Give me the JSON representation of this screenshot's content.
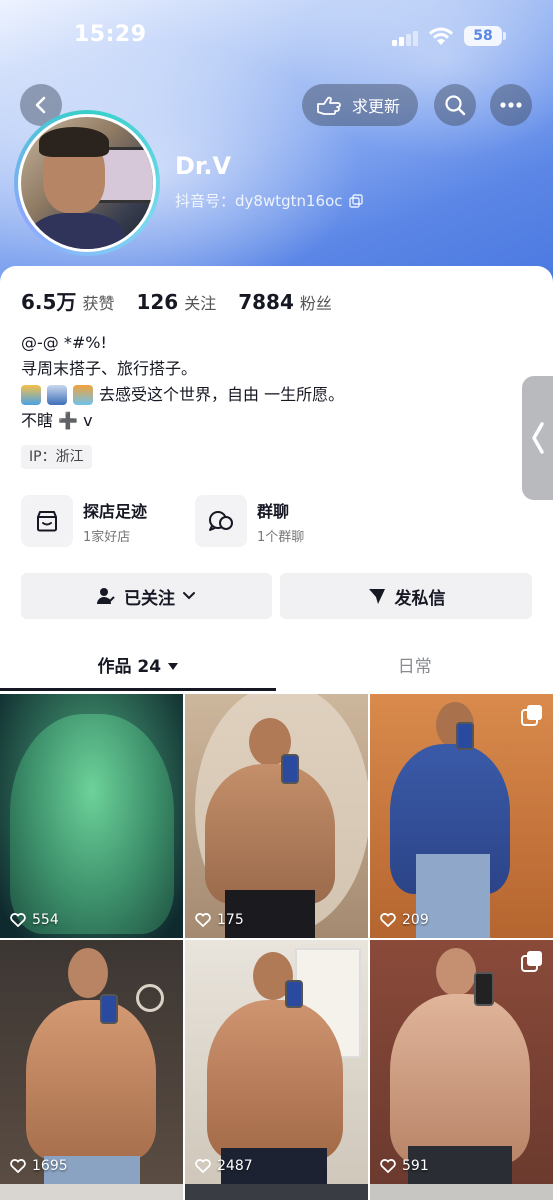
{
  "status_bar": {
    "time": "15:29",
    "battery": "58"
  },
  "top_actions": {
    "update_label": "求更新"
  },
  "profile": {
    "name": "Dr.V",
    "douyin_id": "抖音号：dy8wtgtn16oc"
  },
  "stats": [
    {
      "num": "6.5万",
      "label": "获赞"
    },
    {
      "num": "126",
      "label": "关注"
    },
    {
      "num": "7884",
      "label": "粉丝"
    }
  ],
  "bio": {
    "line1": "@-@ *#%!",
    "line2": "寻周末搭子、旅行搭子。",
    "line3": "去感受这个世界，自由 一生所愿。",
    "line4": "不瞎 ➕ v"
  },
  "ip": "IP：浙江",
  "features": [
    {
      "title": "探店足迹",
      "sub": "1家好店"
    },
    {
      "title": "群聊",
      "sub": "1个群聊"
    }
  ],
  "actions": {
    "follow_label": "已关注",
    "message_label": "发私信"
  },
  "tabs": [
    {
      "label": "作品 24"
    },
    {
      "label": "日常"
    }
  ],
  "videos": [
    {
      "likes": "554",
      "multi": false
    },
    {
      "likes": "175",
      "multi": false
    },
    {
      "likes": "209",
      "multi": true
    },
    {
      "likes": "1695",
      "multi": false
    },
    {
      "likes": "2487",
      "multi": false
    },
    {
      "likes": "591",
      "multi": true
    }
  ],
  "colors": {
    "accent_dark": "#161823",
    "header_blue": "#5b86e6",
    "chip_bg": "#f1f1f3"
  }
}
